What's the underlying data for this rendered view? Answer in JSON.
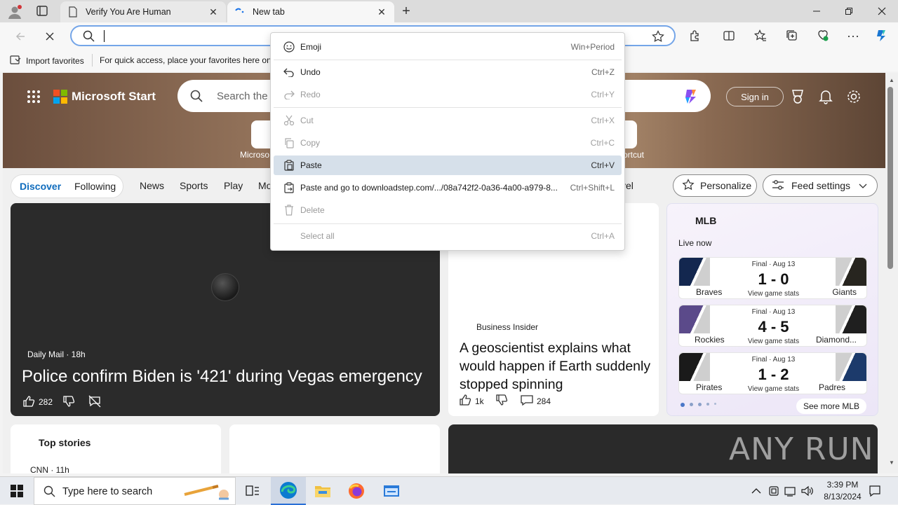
{
  "browser": {
    "tabs": [
      {
        "title": "Verify You Are Human"
      },
      {
        "title": "New tab"
      }
    ],
    "favorites_bar": {
      "import_label": "Import favorites",
      "hint": "For quick access, place your favorites here on t"
    }
  },
  "context_menu": {
    "items": [
      {
        "label": "Emoji",
        "shortcut": "Win+Period",
        "icon": "emoji-icon",
        "disabled": false
      },
      {
        "label": "Undo",
        "shortcut": "Ctrl+Z",
        "icon": "undo-icon",
        "disabled": false
      },
      {
        "label": "Redo",
        "shortcut": "Ctrl+Y",
        "icon": "redo-icon",
        "disabled": true
      },
      {
        "label": "Cut",
        "shortcut": "Ctrl+X",
        "icon": "cut-icon",
        "disabled": true
      },
      {
        "label": "Copy",
        "shortcut": "Ctrl+C",
        "icon": "copy-icon",
        "disabled": true
      },
      {
        "label": "Paste",
        "shortcut": "Ctrl+V",
        "icon": "paste-icon",
        "disabled": false,
        "highlighted": true
      },
      {
        "label": "Paste and go to downloadstep.com/.../08a742f2-0a36-4a00-a979-8...",
        "shortcut": "Ctrl+Shift+L",
        "icon": "paste-go-icon",
        "disabled": false
      },
      {
        "label": "Delete",
        "shortcut": "",
        "icon": "delete-icon",
        "disabled": true
      },
      {
        "label": "Select all",
        "shortcut": "Ctrl+A",
        "icon": "",
        "disabled": true
      }
    ]
  },
  "page": {
    "brand": "Microsoft Start",
    "search_placeholder": "Search the",
    "sign_in": "Sign in",
    "quick_links": {
      "left_label": "Microso",
      "right_label": "ortcut"
    },
    "nav": {
      "discover": "Discover",
      "following": "Following",
      "items": [
        "News",
        "Sports",
        "Play",
        "Mo"
      ],
      "travel_partial": "vel",
      "personalize": "Personalize",
      "feed_settings": "Feed settings"
    },
    "hero_story": {
      "source": "Daily Mail · 18h",
      "headline": "Police confirm Biden is '421' during Vegas emergency",
      "likes": "282"
    },
    "mid_story": {
      "source": "Business Insider",
      "headline": "A geoscientist explains what would happen if Earth suddenly stopped spinning",
      "likes": "1k",
      "comments": "284"
    },
    "mlb": {
      "title": "MLB",
      "live_now": "Live now",
      "games": [
        {
          "status": "Final · Aug 13",
          "score": "1 - 0",
          "home": "Braves",
          "away": "Giants",
          "stats": "View game stats",
          "home_color": "#13274f",
          "away_color": "#27251f"
        },
        {
          "status": "Final · Aug 13",
          "score": "4 - 5",
          "home": "Rockies",
          "away": "Diamond...",
          "stats": "View game stats",
          "home_color": "#5b4a8a",
          "away_color": "#1f1f1f"
        },
        {
          "status": "Final · Aug 13",
          "score": "1 - 2",
          "home": "Pirates",
          "away": "Padres",
          "stats": "View game stats",
          "home_color": "#1a1a1a",
          "away_color": "#1c3a6b"
        }
      ],
      "see_more": "See more MLB"
    },
    "top_stories": {
      "title": "Top stories",
      "source": "CNN · 11h"
    },
    "watermark": "ANY RUN"
  },
  "taskbar": {
    "search_placeholder": "Type here to search",
    "time": "3:39 PM",
    "date": "8/13/2024"
  }
}
